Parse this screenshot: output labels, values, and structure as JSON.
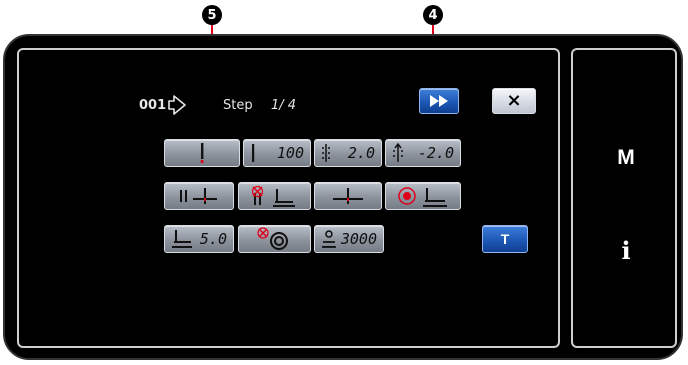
{
  "callouts": {
    "c5": "5",
    "c4": "4"
  },
  "header": {
    "pattern_number": "001",
    "step_label": "Step",
    "step_value": "1/ 4"
  },
  "top_buttons": {
    "next_icon": "fast-forward-icon",
    "close_label": "×"
  },
  "row1": [
    {
      "icon": "needle-icon",
      "value": ""
    },
    {
      "icon": "needle-icon",
      "value": "100"
    },
    {
      "icon": "stitch-length-icon",
      "value": "2.0"
    },
    {
      "icon": "reverse-stitch-icon",
      "value": "-2.0"
    }
  ],
  "row2": [
    {
      "icon": "thread-trim-icon"
    },
    {
      "icon": "presser-lift-off-icon"
    },
    {
      "icon": "needle-stop-icon"
    },
    {
      "icon": "presser-up-icon"
    }
  ],
  "row3": [
    {
      "icon": "presser-foot-icon",
      "value": "5.0"
    },
    {
      "icon": "thread-tension-off-icon",
      "value": ""
    },
    {
      "icon": "speed-icon",
      "value": "3000"
    }
  ],
  "t_button_label": "T",
  "side": {
    "m_label": "M",
    "info_label": "i"
  },
  "colors": {
    "button_grey": "#8c939d",
    "button_blue": "#1d58b6",
    "accent_red": "#e0001a",
    "bezel": "#000000"
  }
}
